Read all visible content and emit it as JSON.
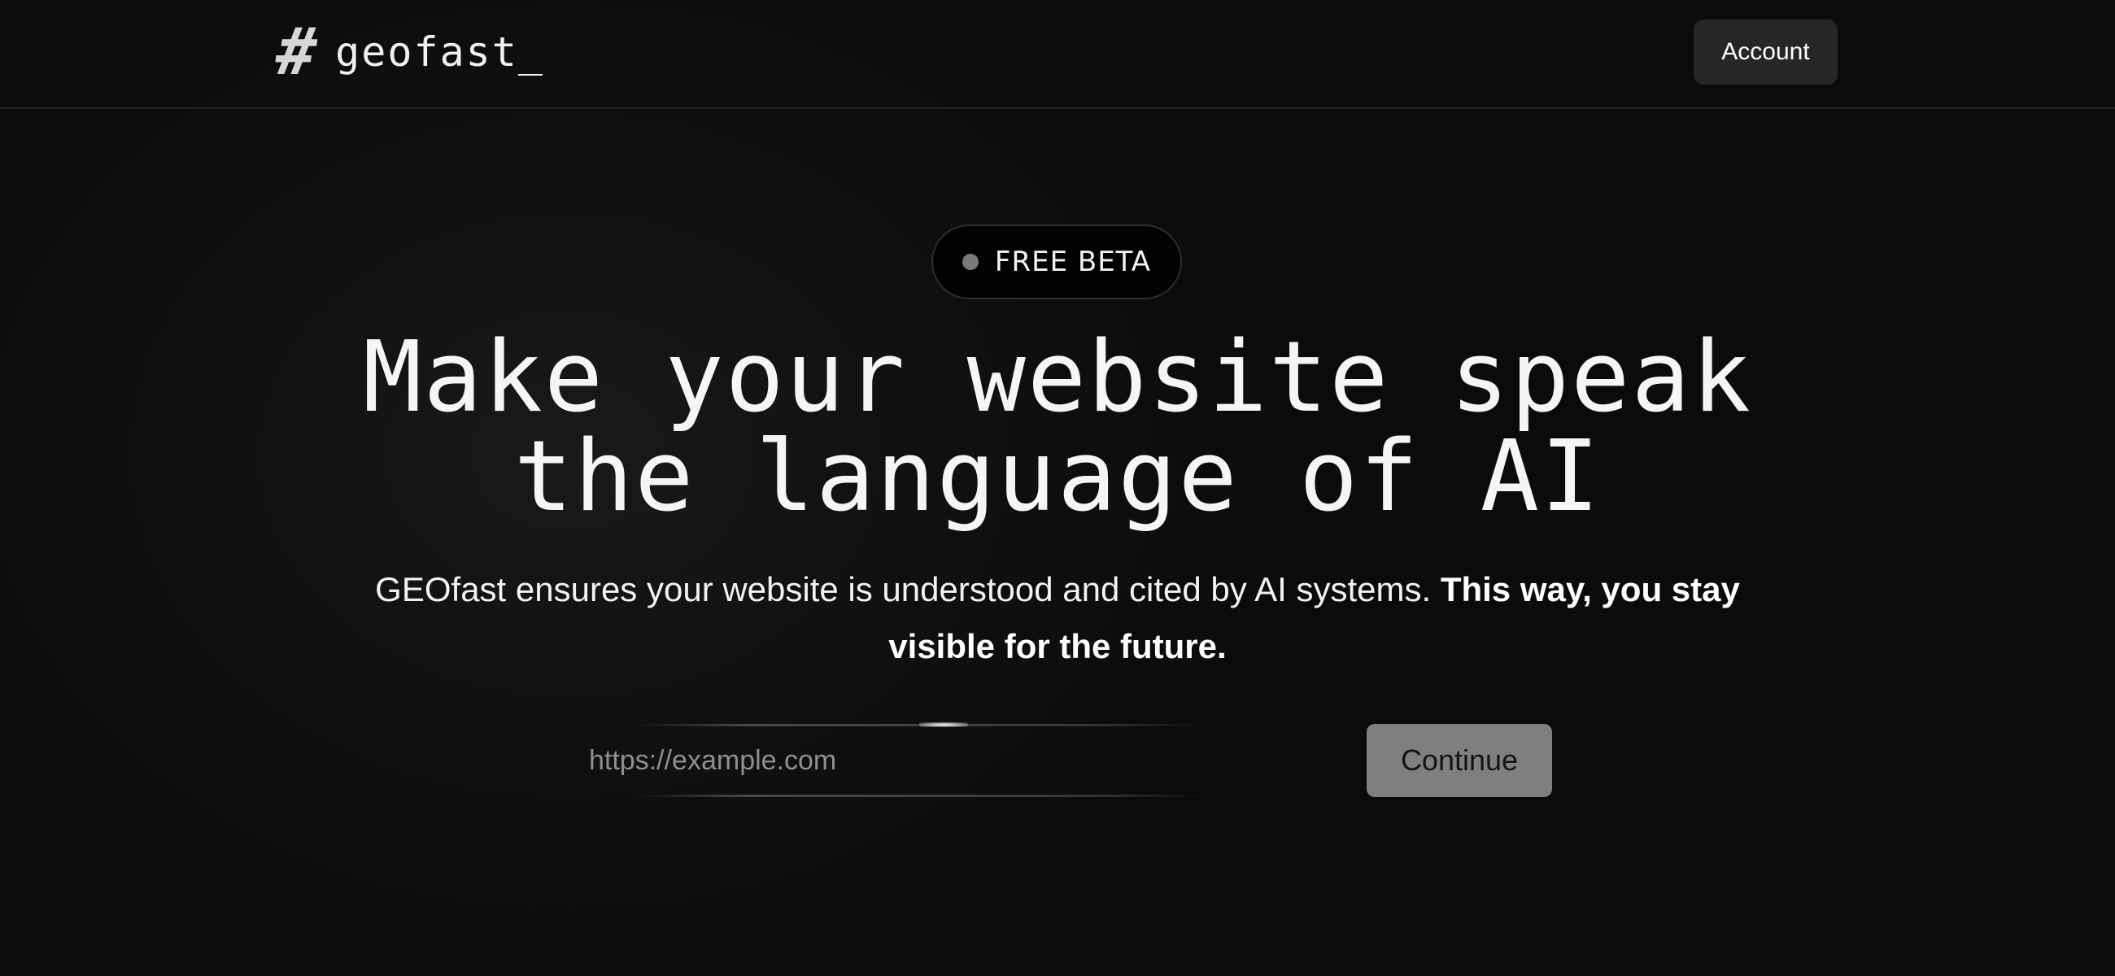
{
  "header": {
    "logo_icon": "hash-icon",
    "logo_symbol": "#",
    "logo_text": "geofast_",
    "account_label": "Account"
  },
  "hero": {
    "badge_label": "FREE BETA",
    "headline_line1": "Make your website speak",
    "headline_line2": "the language of AI",
    "subtitle_regular": "GEOfast ensures your website is understood and cited by AI systems.",
    "subtitle_bold": "This way, you stay visible for the future."
  },
  "form": {
    "url_placeholder": "https://example.com",
    "url_value": "",
    "continue_label": "Continue"
  },
  "colors": {
    "background": "#0b0b0b",
    "account_button": "#262626",
    "continue_button": "#7f7f7f",
    "badge_dot": "#7a7a7a"
  }
}
